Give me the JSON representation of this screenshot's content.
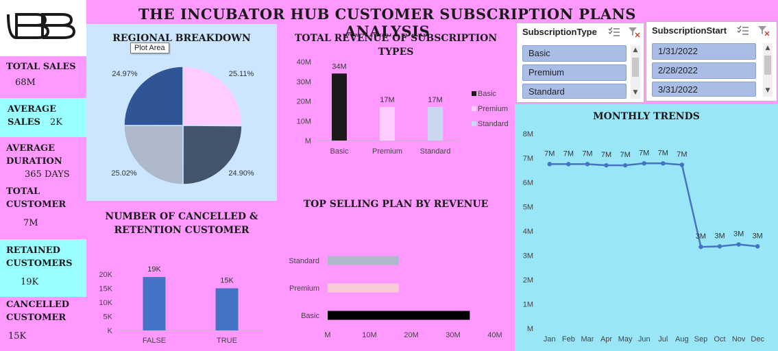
{
  "title": "THE INCUBATOR HUB CUSTOMER SUBSCRIPTION PLANS ANALYSIS",
  "logo": {
    "icon": "bb-monogram-icon"
  },
  "kpis": {
    "total_sales": {
      "label": "TOTAL SALES",
      "value": "68M"
    },
    "average_sales": {
      "label_line1": "AVERAGE",
      "label_line2": "SALES",
      "value": "2K"
    },
    "average_duration": {
      "label_line1": "AVERAGE",
      "label_line2": "DURATION",
      "value": "365 DAYS"
    },
    "total_customer": {
      "label_line1": "TOTAL",
      "label_line2": "CUSTOMER",
      "value": "7M"
    },
    "retained_customers": {
      "label_line1": "RETAINED",
      "label_line2": "CUSTOMERS",
      "value": "19K"
    },
    "cancelled_customer": {
      "label_line1": "CANCELLED",
      "label_line2": "CUSTOMER",
      "value": "15K"
    }
  },
  "tooltip": "Plot Area",
  "colors": {
    "background": "#ff99ff",
    "cyan": "#99ffff",
    "line": "#4472c4",
    "bar_blue": "#4472c4"
  },
  "slicers": [
    {
      "header": "SubscriptionType",
      "items": [
        "Basic",
        "Premium",
        "Standard"
      ]
    },
    {
      "header": "SubscriptionStart",
      "items": [
        "1/31/2022",
        "2/28/2022",
        "3/31/2022"
      ]
    }
  ],
  "chart_data": [
    {
      "id": "regional",
      "type": "pie",
      "title": "REGIONAL BREAKDOWN",
      "slices": [
        {
          "value": 25.11,
          "label": "25.11%",
          "color": "#ffccff"
        },
        {
          "value": 24.9,
          "label": "24.90%",
          "color": "#44546a"
        },
        {
          "value": 25.02,
          "label": "25.02%",
          "color": "#adb9ca"
        },
        {
          "value": 24.97,
          "label": "24.97%",
          "color": "#2f5597"
        }
      ]
    },
    {
      "id": "revenue_types",
      "type": "bar",
      "title_line1": "TOTAL REVENUE OF SUBSCRIPTION",
      "title_line2": "TYPES",
      "categories": [
        "Basic",
        "Premium",
        "Standard"
      ],
      "values": [
        34,
        17,
        17
      ],
      "data_labels": [
        "34M",
        "17M",
        "17M"
      ],
      "colors": [
        "#1a1a1a",
        "#ffccff",
        "#c9d7f0"
      ],
      "ylim": [
        0,
        40
      ],
      "yticks": [
        "M",
        "10M",
        "20M",
        "30M",
        "40M"
      ],
      "legend": [
        "Basic",
        "Premium",
        "Standard"
      ],
      "legend_position": "right"
    },
    {
      "id": "cancel_retention",
      "type": "bar",
      "title_line1": "NUMBER OF CANCELLED &",
      "title_line2": "RETENTION CUSTOMER",
      "categories": [
        "FALSE",
        "TRUE"
      ],
      "values": [
        19,
        15
      ],
      "data_labels": [
        "19K",
        "15K"
      ],
      "ylim": [
        0,
        20
      ],
      "yticks": [
        "K",
        "5K",
        "10K",
        "15K",
        "20K"
      ]
    },
    {
      "id": "top_selling",
      "type": "bar",
      "orientation": "horizontal",
      "title": "TOP SELLING PLAN BY REVENUE",
      "categories": [
        "Standard",
        "Premium",
        "Basic"
      ],
      "values": [
        17,
        17,
        34
      ],
      "colors": [
        "#adb9ca",
        "#f8cbd6",
        "#000000"
      ],
      "xlim": [
        0,
        40
      ],
      "xticks": [
        "M",
        "10M",
        "20M",
        "30M",
        "40M"
      ]
    },
    {
      "id": "monthly",
      "type": "line",
      "title": "MONTHLY TRENDS",
      "categories": [
        "Jan",
        "Feb",
        "Mar",
        "Apr",
        "May",
        "Jun",
        "Jul",
        "Aug",
        "Sep",
        "Oct",
        "Nov",
        "Dec"
      ],
      "values": [
        6.75,
        6.75,
        6.75,
        6.7,
        6.7,
        6.78,
        6.78,
        6.72,
        3.35,
        3.37,
        3.45,
        3.37
      ],
      "data_labels": [
        "7M",
        "7M",
        "7M",
        "7M",
        "7M",
        "7M",
        "7M",
        "7M",
        "3M",
        "3M",
        "3M",
        "3M"
      ],
      "ylim": [
        0,
        8
      ],
      "yticks": [
        "M",
        "1M",
        "2M",
        "3M",
        "4M",
        "5M",
        "6M",
        "7M",
        "8M"
      ]
    }
  ]
}
